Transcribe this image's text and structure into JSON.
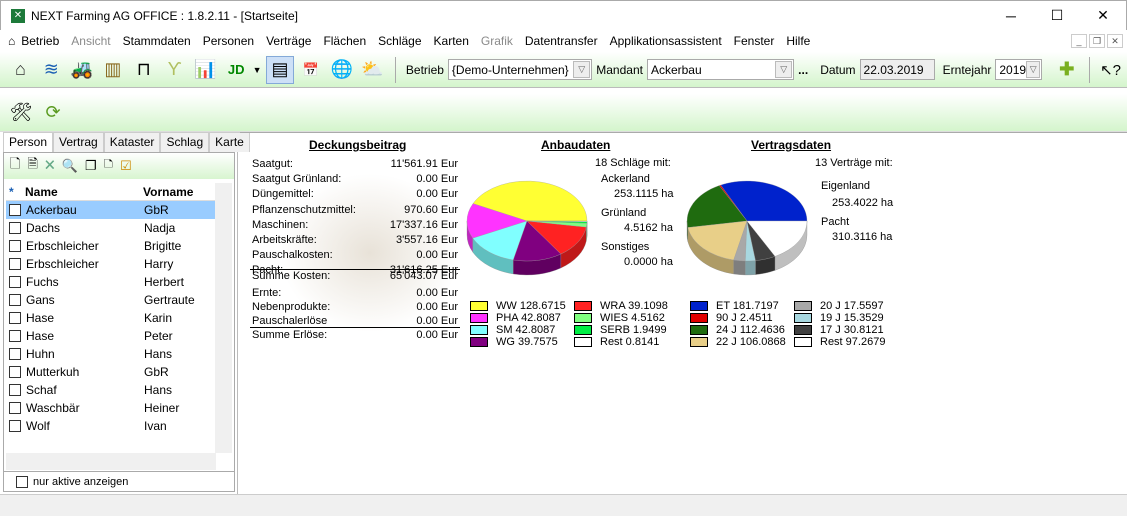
{
  "window": {
    "title": "NEXT Farming AG OFFICE : 1.8.2.11 - [Startseite]",
    "minimize": "─",
    "maximize": "☐",
    "close": "✕"
  },
  "menu": [
    {
      "label": "Betrieb",
      "disabled": false
    },
    {
      "label": "Ansicht",
      "disabled": true
    },
    {
      "label": "Stammdaten",
      "disabled": false
    },
    {
      "label": "Personen",
      "disabled": false
    },
    {
      "label": "Verträge",
      "disabled": false
    },
    {
      "label": "Flächen",
      "disabled": false
    },
    {
      "label": "Schläge",
      "disabled": false
    },
    {
      "label": "Karten",
      "disabled": false
    },
    {
      "label": "Grafik",
      "disabled": true
    },
    {
      "label": "Datentransfer",
      "disabled": false
    },
    {
      "label": "Applikationsassistent",
      "disabled": false
    },
    {
      "label": "Fenster",
      "disabled": false
    },
    {
      "label": "Hilfe",
      "disabled": false
    }
  ],
  "toolbar": {
    "betrieb_label": "Betrieb",
    "betrieb_value": "{Demo-Unternehmen}",
    "mandant_label": "Mandant",
    "mandant_value": "Ackerbau",
    "more": "...",
    "datum_label": "Datum",
    "datum_value": "22.03.2019",
    "erntejahr_label": "Erntejahr",
    "erntejahr_value": "2019"
  },
  "left": {
    "tabs": [
      "Person",
      "Vertrag",
      "Kataster",
      "Schlag",
      "Karte"
    ],
    "active_tab": "Person",
    "col_star": "*",
    "col_name": "Name",
    "col_vorname": "Vorname",
    "rows": [
      [
        "Ackerbau",
        "GbR"
      ],
      [
        "Dachs",
        "Nadja"
      ],
      [
        "Erbschleicher",
        "Brigitte"
      ],
      [
        "Erbschleicher",
        "Harry"
      ],
      [
        "Fuchs",
        "Herbert"
      ],
      [
        "Gans",
        "Gertraute"
      ],
      [
        "Hase",
        "Karin"
      ],
      [
        "Hase",
        "Peter"
      ],
      [
        "Huhn",
        "Hans"
      ],
      [
        "Mutterkuh",
        "GbR"
      ],
      [
        "Schaf",
        "Hans"
      ],
      [
        "Waschbär",
        "Heiner"
      ],
      [
        "Wolf",
        "Ivan"
      ]
    ],
    "selected_row": 0,
    "filter_label": "nur aktive anzeigen"
  },
  "deckungsbeitrag": {
    "title": "Deckungsbeitrag",
    "kosten": [
      [
        "Saatgut:",
        "11'561.91 Eur"
      ],
      [
        "Saatgut Grünland:",
        "0.00 Eur"
      ],
      [
        "Düngemittel:",
        "0.00 Eur"
      ],
      [
        "Pflanzenschutzmittel:",
        "970.60 Eur"
      ],
      [
        "Maschinen:",
        "17'337.16 Eur"
      ],
      [
        "Arbeitskräfte:",
        "3'557.16 Eur"
      ],
      [
        "Pauschalkosten:",
        "0.00 Eur"
      ],
      [
        "Pacht:",
        "31'616.25 Eur"
      ]
    ],
    "summe_kosten": [
      "Summe Kosten:",
      "65'043.07 Eur"
    ],
    "erloese": [
      [
        "Ernte:",
        "0.00 Eur"
      ],
      [
        "Nebenprodukte:",
        "0.00 Eur"
      ],
      [
        "Pauschalerlöse",
        "0.00 Eur"
      ]
    ],
    "summe_erloese": [
      "Summe Erlöse:",
      "0.00 Eur"
    ]
  },
  "anbaudaten": {
    "title": "Anbaudaten",
    "count": "18 Schläge mit:",
    "ackerland_label": "Ackerland",
    "ackerland": "253.1115 ha",
    "gruenland_label": "Grünland",
    "gruenland": "4.5162 ha",
    "sonstiges_label": "Sonstiges",
    "sonstiges": "0.0000 ha"
  },
  "vertragsdaten": {
    "title": "Vertragsdaten",
    "count": "13 Verträge mit:",
    "eigenland_label": "Eigenland",
    "eigenland": "253.4022 ha",
    "pacht_label": "Pacht",
    "pacht": "310.3116 ha"
  },
  "chart_data": [
    {
      "type": "pie",
      "title": "Anbaudaten",
      "slices": [
        {
          "name": "WW",
          "value": 128.6715,
          "color": "#ffff33",
          "label": "WW 128.6715"
        },
        {
          "name": "PHA",
          "value": 42.8087,
          "color": "#ff33ff",
          "label": "PHA 42.8087"
        },
        {
          "name": "SM",
          "value": 42.8087,
          "color": "#80ffff",
          "label": "SM 42.8087"
        },
        {
          "name": "WG",
          "value": 39.7575,
          "color": "#800080",
          "label": "WG 39.7575"
        },
        {
          "name": "WRA",
          "value": 39.1098,
          "color": "#ff2222",
          "label": "WRA 39.1098"
        },
        {
          "name": "WIES",
          "value": 4.5162,
          "color": "#80ff80",
          "label": "WIES 4.5162"
        },
        {
          "name": "SERB",
          "value": 1.9499,
          "color": "#00ee44",
          "label": "SERB 1.9499"
        },
        {
          "name": "Rest",
          "value": 0.8141,
          "color": "#ffffff",
          "label": "Rest 0.8141"
        }
      ]
    },
    {
      "type": "pie",
      "title": "Vertragsdaten",
      "slices": [
        {
          "name": "ET",
          "value": 181.7197,
          "color": "#0022cc",
          "label": "ET 181.7197"
        },
        {
          "name": "90 J",
          "value": 2.4511,
          "color": "#e00000",
          "label": "90 J 2.4511"
        },
        {
          "name": "24 J",
          "value": 112.4636,
          "color": "#1f6b0f",
          "label": "24 J 112.4636"
        },
        {
          "name": "22 J",
          "value": 106.0868,
          "color": "#e8cf88",
          "label": "22 J 106.0868"
        },
        {
          "name": "20 J",
          "value": 17.5597,
          "color": "#a8a8a8",
          "label": "20 J 17.5597"
        },
        {
          "name": "19 J",
          "value": 15.3529,
          "color": "#a8d8e0",
          "label": "19 J 15.3529"
        },
        {
          "name": "17 J",
          "value": 30.8121,
          "color": "#404040",
          "label": "17 J 30.8121"
        },
        {
          "name": "Rest",
          "value": 97.2679,
          "color": "#ffffff",
          "label": "Rest 97.2679"
        }
      ]
    }
  ]
}
